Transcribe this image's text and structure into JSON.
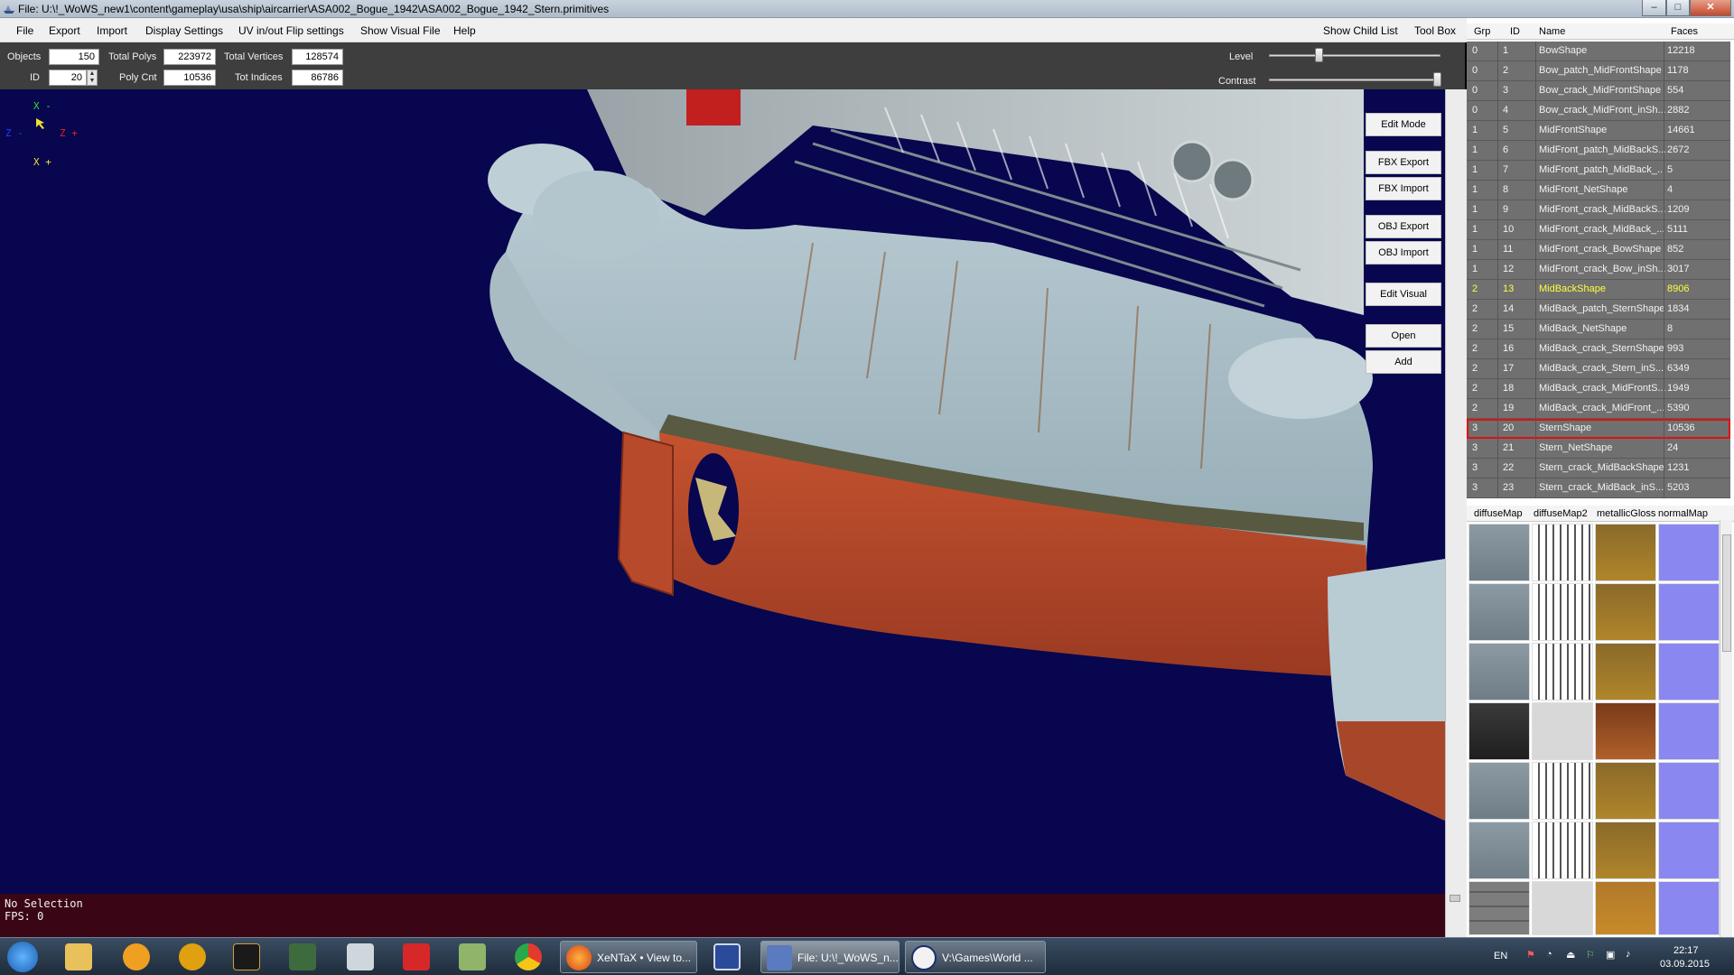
{
  "window": {
    "title": "File: U:\\!_WoWS_new1\\content\\gameplay\\usa\\ship\\aircarrier\\ASA002_Bogue_1942\\ASA002_Bogue_1942_Stern.primitives",
    "min_glyph": "–",
    "max_glyph": "□",
    "close_glyph": "✕"
  },
  "menu": {
    "items": [
      "File",
      "Export",
      "Import",
      "Display Settings",
      "UV in/out Flip settings",
      "Show Visual File",
      "Help"
    ],
    "right_items": [
      "Show Child List",
      "Tool Box"
    ]
  },
  "toolbar": {
    "objects_label": "Objects",
    "objects_value": "150",
    "id_label": "ID",
    "id_value": "20",
    "total_polys_label": "Total Polys",
    "total_polys_value": "223972",
    "poly_cnt_label": "Poly Cnt",
    "poly_cnt_value": "10536",
    "total_vertices_label": "Total Vertices",
    "total_vertices_value": "128574",
    "tot_indices_label": "Tot Indices",
    "tot_indices_value": "86786",
    "level_label": "Level",
    "contrast_label": "Contrast",
    "level_fraction": 0.29,
    "contrast_fraction": 0.98
  },
  "viewport": {
    "axes": {
      "x_top": "X -",
      "z_left": "Z -",
      "z_right": "Z +",
      "x_bottom": "X +"
    },
    "buttons": [
      "Edit Mode",
      "FBX Export",
      "FBX Import",
      "OBJ Export",
      "OBJ Import",
      "Edit Visual",
      "Open",
      "Add"
    ],
    "status_line1": "No Selection",
    "status_line2": "FPS: 0"
  },
  "object_list": {
    "columns": [
      "Grp",
      "ID",
      "Name",
      "Faces"
    ],
    "rows": [
      {
        "grp": "0",
        "id": "1",
        "name": "BowShape",
        "faces": "12218"
      },
      {
        "grp": "0",
        "id": "2",
        "name": "Bow_patch_MidFrontShape",
        "faces": "1178"
      },
      {
        "grp": "0",
        "id": "3",
        "name": "Bow_crack_MidFrontShape",
        "faces": "554"
      },
      {
        "grp": "0",
        "id": "4",
        "name": "Bow_crack_MidFront_inSh...",
        "faces": "2882"
      },
      {
        "grp": "1",
        "id": "5",
        "name": "MidFrontShape",
        "faces": "14661"
      },
      {
        "grp": "1",
        "id": "6",
        "name": "MidFront_patch_MidBackS...",
        "faces": "2672"
      },
      {
        "grp": "1",
        "id": "7",
        "name": "MidFront_patch_MidBack_...",
        "faces": "5"
      },
      {
        "grp": "1",
        "id": "8",
        "name": "MidFront_NetShape",
        "faces": "4"
      },
      {
        "grp": "1",
        "id": "9",
        "name": "MidFront_crack_MidBackS...",
        "faces": "1209"
      },
      {
        "grp": "1",
        "id": "10",
        "name": "MidFront_crack_MidBack_...",
        "faces": "5111"
      },
      {
        "grp": "1",
        "id": "11",
        "name": "MidFront_crack_BowShape",
        "faces": "852"
      },
      {
        "grp": "1",
        "id": "12",
        "name": "MidFront_crack_Bow_inSh...",
        "faces": "3017"
      },
      {
        "grp": "2",
        "id": "13",
        "name": "MidBackShape",
        "faces": "8906"
      },
      {
        "grp": "2",
        "id": "14",
        "name": "MidBack_patch_SternShape",
        "faces": "1834"
      },
      {
        "grp": "2",
        "id": "15",
        "name": "MidBack_NetShape",
        "faces": "8"
      },
      {
        "grp": "2",
        "id": "16",
        "name": "MidBack_crack_SternShape",
        "faces": "993"
      },
      {
        "grp": "2",
        "id": "17",
        "name": "MidBack_crack_Stern_inS...",
        "faces": "6349"
      },
      {
        "grp": "2",
        "id": "18",
        "name": "MidBack_crack_MidFrontS...",
        "faces": "1949"
      },
      {
        "grp": "2",
        "id": "19",
        "name": "MidBack_crack_MidFront_...",
        "faces": "5390"
      },
      {
        "grp": "3",
        "id": "20",
        "name": "SternShape",
        "faces": "10536"
      },
      {
        "grp": "3",
        "id": "21",
        "name": "Stern_NetShape",
        "faces": "24"
      },
      {
        "grp": "3",
        "id": "22",
        "name": "Stern_crack_MidBackShape",
        "faces": "1231"
      },
      {
        "grp": "3",
        "id": "23",
        "name": "Stern_crack_MidBack_inS...",
        "faces": "5203"
      }
    ],
    "highlighted_id": "13",
    "selected_id": "20"
  },
  "texture_list": {
    "columns": [
      "diffuseMap",
      "diffuseMap2",
      "metallicGloss",
      "normalMap"
    ]
  },
  "taskbar": {
    "tasks": [
      "XeNTaX • View to...",
      "File: U:\\!_WoWS_n...",
      "V:\\Games\\World ..."
    ],
    "language": "EN",
    "time": "22:17",
    "date": "03.09.2015"
  },
  "colors": {
    "viewport_bg": "#07064e",
    "status_bg": "#3a0515",
    "row_bg": "#707070",
    "highlight_text": "#ffff40",
    "selection_outline": "#e01010"
  }
}
